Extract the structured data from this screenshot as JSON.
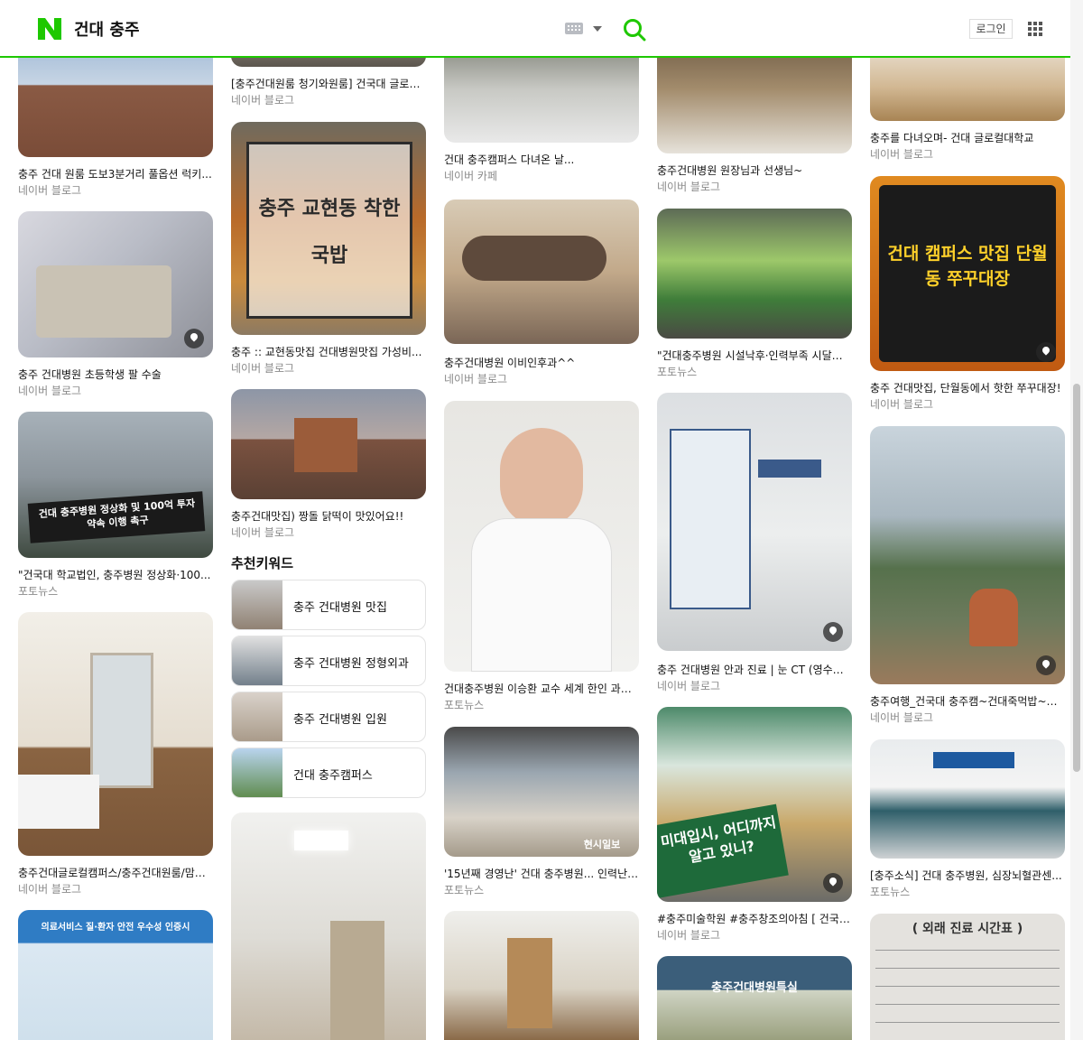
{
  "header": {
    "query": "건대 충주",
    "login_label": "로그인"
  },
  "colors": {
    "naver_green": "#1ec800",
    "source_gray": "#8a8a8a"
  },
  "icons": [
    "naver-logo",
    "keyboard-icon",
    "dropdown-icon",
    "search-icon",
    "apps-grid-icon",
    "map-pin-icon"
  ],
  "keywords": {
    "title": "추천키워드",
    "items": [
      {
        "label": "충주 건대병원 맛집"
      },
      {
        "label": "충주 건대병원 정형외과"
      },
      {
        "label": "충주 건대병원 입원"
      },
      {
        "label": "건대 충주캠퍼스"
      }
    ]
  },
  "cards": [
    {
      "caption": "충주 건대 원룸 도보3분거리 풀옵션 럭키...",
      "source": "네이버 블로그"
    },
    {
      "caption": "충주 건대병원 초등학생 팔 수술",
      "source": "네이버 블로그"
    },
    {
      "caption": "\"건국대 학교법인, 충주병원 정상화·100...",
      "source": "포토뉴스",
      "overlay": "건대 충주병원 정상화 및 100억 투자약속 이행 촉구"
    },
    {
      "caption": "충주건대글로컬캠퍼스/충주건대원룸/맘스...",
      "source": "네이버 블로그"
    },
    {
      "overlay": "의료서비스 질·환자 안전 우수성 인증시"
    },
    {
      "caption": "[충주건대원룸 청기와원룸] 건국대 글로컬...",
      "source": "네이버 블로그"
    },
    {
      "caption": "충주 :: 교현동맛집 건대병원맛집 가성비...",
      "source": "네이버 블로그",
      "overlay": "충주 교현동 착한국밥"
    },
    {
      "caption": "충주건대맛집) 짱돌 닭떡이 맛있어요!!",
      "source": "네이버 블로그"
    },
    {},
    {
      "caption": "건대 충주캠퍼스 다녀온 날...",
      "source": "네이버 카페"
    },
    {
      "caption": "충주건대병원 이비인후과^^",
      "source": "네이버 블로그"
    },
    {
      "caption": "건대충주병원 이승환 교수 세계 한인 과학...",
      "source": "포토뉴스"
    },
    {
      "caption": "'15년째 경영난' 건대 충주병원... 인력난·...",
      "source": "포토뉴스",
      "overlay": "현시일보"
    },
    {},
    {
      "caption": "충주건대병원 원장님과 선생님~",
      "source": "네이버 블로그"
    },
    {
      "caption": "\"건대충주병원 시설낙후·인력부족 시달려....",
      "source": "포토뉴스"
    },
    {
      "caption": "충주 건대병원 안과 진료 | 눈 CT (영수증...",
      "source": "네이버 블로그"
    },
    {
      "caption": "#충주미술학원 #충주창조의아침 [ 건국대...",
      "source": "네이버 블로그",
      "overlay": "미대입시, 어디까지 알고 있니?"
    },
    {
      "overlay": "충주건대병원특실"
    },
    {
      "caption": "충주를 다녀오며- 건대 글로컬대학교",
      "source": "네이버 블로그"
    },
    {
      "caption": "충주 건대맛집, 단월동에서 핫한 쭈꾸대장!",
      "source": "네이버 블로그",
      "overlay": "건대 캠퍼스 맛집 단월동 쭈꾸대장"
    },
    {
      "caption": "충주여행_건국대 충주캠~건대죽먹밥~충...",
      "source": "네이버 블로그"
    },
    {
      "caption": "[충주소식] 건대 충주병원, 심장뇌혈관센...",
      "source": "포토뉴스"
    },
    {
      "overlay": "( 외래 진료 시간표 )"
    }
  ]
}
